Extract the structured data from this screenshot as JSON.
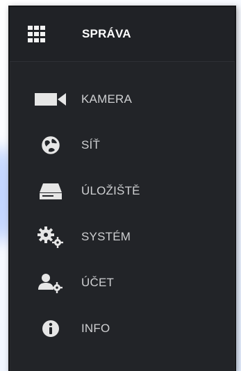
{
  "menu": {
    "header": {
      "title": "SPRÁVA",
      "icon": "grid-icon"
    },
    "items": [
      {
        "label": "KAMERA",
        "icon": "camera-icon"
      },
      {
        "label": "SÍŤ",
        "icon": "network-globe-icon"
      },
      {
        "label": "ÚLOŽIŠTĚ",
        "icon": "storage-drive-icon"
      },
      {
        "label": "SYSTÉM",
        "icon": "gears-icon"
      },
      {
        "label": "ÚČET",
        "icon": "user-settings-icon"
      },
      {
        "label": "INFO",
        "icon": "info-icon"
      }
    ]
  },
  "colors": {
    "panel_background": "#222428",
    "header_text": "#ffffff",
    "item_text": "#cfd0d2",
    "icon_color": "#e6e6e6"
  }
}
